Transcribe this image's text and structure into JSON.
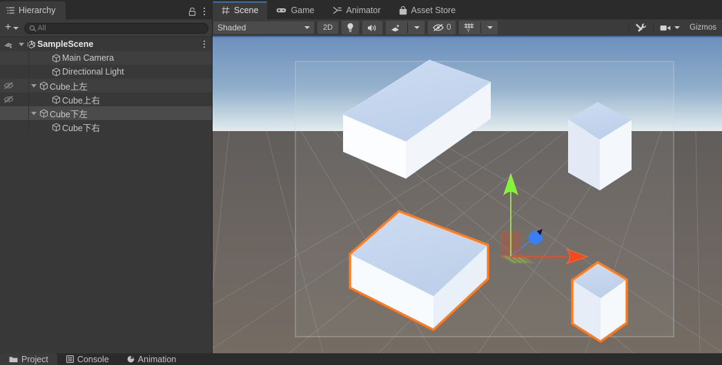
{
  "hierarchy": {
    "tab_label": "Hierarchy",
    "lock_icon": "lock-icon",
    "menu_icon": "kebab-menu-icon",
    "toolbar": {
      "create_label": "+",
      "search_placeholder": "All",
      "search_value": ""
    },
    "items": [
      {
        "label": "SampleScene",
        "depth": 0,
        "icon": "unity-scene-icon",
        "expanded": true,
        "selected": false,
        "hidden_toggle": false,
        "kebab": true
      },
      {
        "label": "Main Camera",
        "depth": 2,
        "icon": "gameobject-cube-icon",
        "expanded": null,
        "selected": false,
        "hidden_toggle": false,
        "kebab": false
      },
      {
        "label": "Directional Light",
        "depth": 2,
        "icon": "gameobject-cube-icon",
        "expanded": null,
        "selected": false,
        "hidden_toggle": false,
        "kebab": false
      },
      {
        "label": "Cube上左",
        "depth": 1,
        "icon": "gameobject-cube-icon",
        "expanded": true,
        "selected": false,
        "hidden_toggle": true,
        "kebab": false
      },
      {
        "label": "Cube上右",
        "depth": 2,
        "icon": "gameobject-cube-icon",
        "expanded": null,
        "selected": false,
        "hidden_toggle": true,
        "kebab": false
      },
      {
        "label": "Cube下左",
        "depth": 1,
        "icon": "gameobject-cube-icon",
        "expanded": true,
        "selected": true,
        "hidden_toggle": false,
        "kebab": false
      },
      {
        "label": "Cube下右",
        "depth": 2,
        "icon": "gameobject-cube-icon",
        "expanded": null,
        "selected": false,
        "hidden_toggle": false,
        "kebab": false
      }
    ]
  },
  "scene_panel": {
    "tabs": [
      {
        "label": "Scene",
        "icon": "scene-grid-icon",
        "active": true
      },
      {
        "label": "Game",
        "icon": "gamepad-icon",
        "active": false
      },
      {
        "label": "Animator",
        "icon": "animator-icon",
        "active": false
      },
      {
        "label": "Asset Store",
        "icon": "store-bag-icon",
        "active": false
      }
    ],
    "toolbar": {
      "draw_mode": "Shaded",
      "toggle_2d": "2D",
      "lighting_icon": "lightbulb-icon",
      "audio_icon": "audio-speaker-icon",
      "effects_icon": "fx-icon",
      "effects_caret_icon": "chevron-down-icon",
      "hidden_objects_icon": "eye-off-icon",
      "hidden_objects_count": "0",
      "grid_icon": "grid-axis-y-icon",
      "grid_caret_icon": "chevron-down-icon",
      "tools_icon": "tools-icon",
      "camera_icon": "scene-camera-icon",
      "camera_caret_icon": "chevron-down-icon",
      "gizmos_label": "Gizmos"
    }
  },
  "scene_view": {
    "objects": [
      {
        "name": "cube-upper-left-box",
        "selected": false
      },
      {
        "name": "cube-upper-right-box",
        "selected": false
      },
      {
        "name": "cube-lower-left-box",
        "selected": true
      },
      {
        "name": "cube-lower-right-box",
        "selected": true
      }
    ],
    "gizmo": {
      "type": "move-gizmo",
      "axis_y_color": "#7ef43a",
      "axis_x_color": "#f04a1e",
      "axis_z_color": "#3a7ef4"
    },
    "selection_outline_color": "#ff7b1c",
    "sky_top_color": "#6b8fbb",
    "sky_horizon_color": "#d8e3ea",
    "ground_color": "#6a6560"
  },
  "bottom_dock": {
    "tabs": [
      {
        "label": "Project",
        "icon": "folder-icon",
        "active": true
      },
      {
        "label": "Console",
        "icon": "console-icon",
        "active": false
      },
      {
        "label": "Animation",
        "icon": "animation-icon",
        "active": false
      }
    ]
  }
}
